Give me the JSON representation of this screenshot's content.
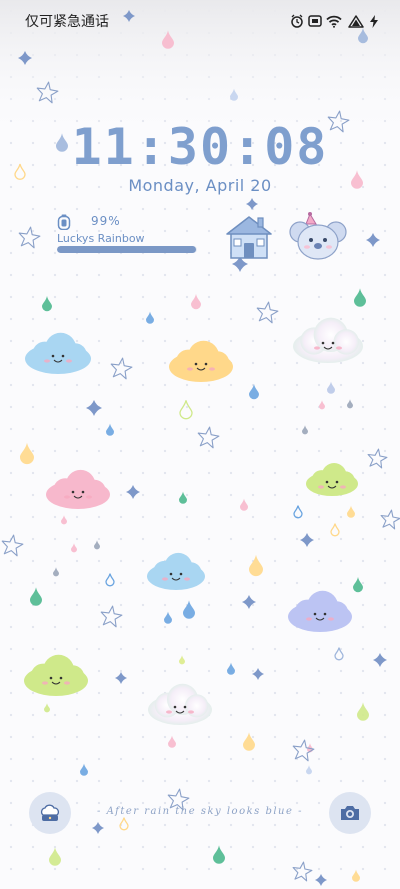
{
  "status_bar": {
    "carrier_text": "仅可紧急通话",
    "icons": [
      "alarm-icon",
      "message-icon",
      "wifi-icon",
      "battery-icon",
      "charging-bolt-icon"
    ]
  },
  "lock_screen": {
    "time": "11:30:08",
    "date": "Monday, April  20"
  },
  "battery_widget": {
    "percent_text": "99%",
    "level": 0.99,
    "name": "Luckys Rainbow"
  },
  "shortcuts": {
    "left_icon": "weather-cloud-icon",
    "right_icon": "camera-icon"
  },
  "tagline": "- After rain the sky looks blue -",
  "colors": {
    "accent": "#7f9fce",
    "date": "#6b8fc4",
    "pink": "#f7b8cc",
    "yellow": "#ffd88a",
    "blue": "#a9d6f2",
    "green": "#cfe98a",
    "lavender": "#bcc4f3",
    "teal": "#4cb88e"
  }
}
